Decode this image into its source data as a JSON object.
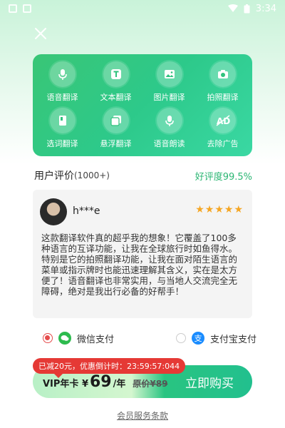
{
  "status_bar": {
    "time": "3:34"
  },
  "features": [
    {
      "label": "语音翻译",
      "icon": "mic-icon"
    },
    {
      "label": "文本翻译",
      "icon": "text-icon"
    },
    {
      "label": "图片翻译",
      "icon": "image-icon"
    },
    {
      "label": "拍照翻译",
      "icon": "camera-icon"
    },
    {
      "label": "选词翻译",
      "icon": "book-icon"
    },
    {
      "label": "悬浮翻译",
      "icon": "float-window-icon"
    },
    {
      "label": "语音朗读",
      "icon": "speaker-mic-icon"
    },
    {
      "label": "去除广告",
      "icon": "ad-block-icon"
    }
  ],
  "reviews": {
    "title": "用户评价",
    "count": "(1000+)",
    "rating": "好评度99.5%",
    "item": {
      "user": "h***e",
      "stars": "★★★★★",
      "text": "这款翻译软件真的超乎我的想象！它覆盖了100多种语言的互译功能，让我在全球旅行时如鱼得水。特别是它的拍照翻译功能，让我在面对陌生语言的菜单或指示牌时也能迅速理解其含义，实在是太方便了！语音翻译也非常实用，与当地人交流完全无障碍，绝对是我出行必备的好帮手！"
    }
  },
  "payment": {
    "wechat_label": "微信支付",
    "alipay_label": "支付宝支付",
    "alipay_glyph": "支",
    "selected": "wechat"
  },
  "purchase": {
    "promo": "已减20元，优惠倒计时：23:59:57:044",
    "vip_label": "VIP年卡 ¥",
    "price": "69",
    "unit": "/年",
    "original": "原价¥89",
    "button": "立即购买"
  },
  "terms": "会员服务条款",
  "colors": {
    "accent": "#2bb673",
    "promo_red": "#e53935",
    "star": "#f5a623"
  }
}
